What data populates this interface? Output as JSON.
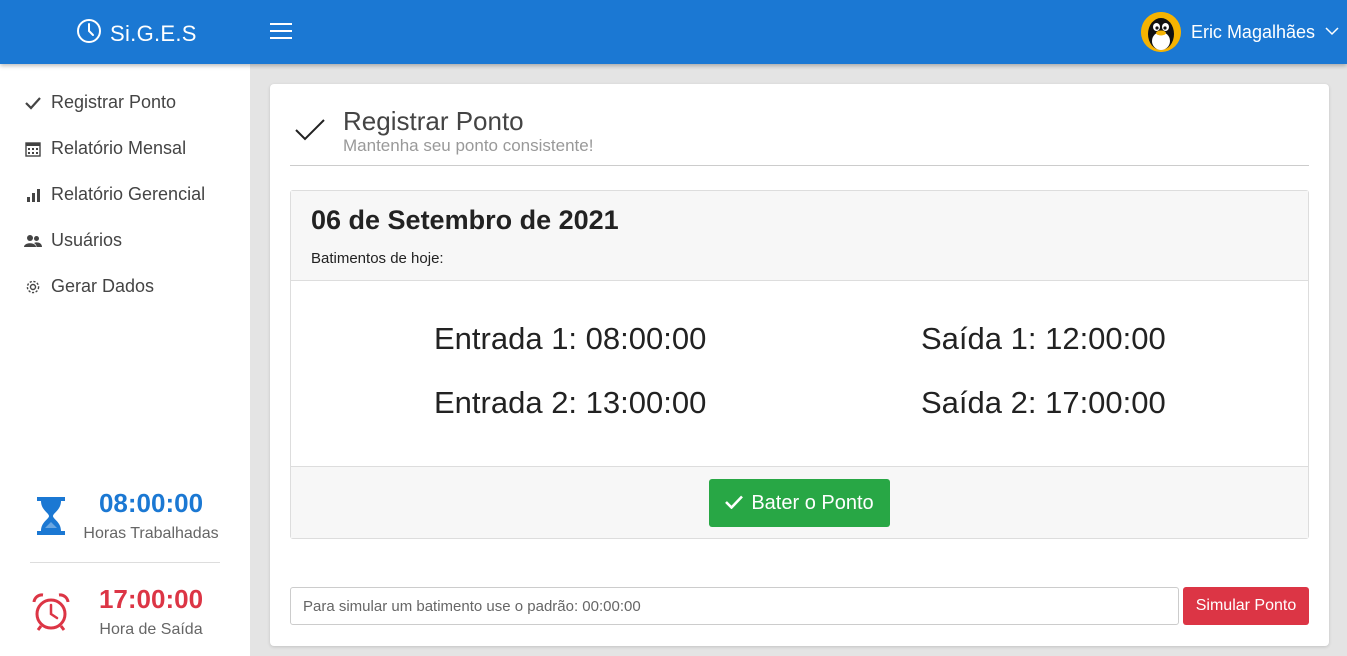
{
  "header": {
    "brand": "Si.G.E.S",
    "user_name": "Eric Magalhães"
  },
  "sidebar": {
    "items": [
      {
        "label": "Registrar Ponto",
        "icon": "check-icon"
      },
      {
        "label": "Relatório Mensal",
        "icon": "calendar-icon"
      },
      {
        "label": "Relatório Gerencial",
        "icon": "bar-chart-icon"
      },
      {
        "label": "Usuários",
        "icon": "users-icon"
      },
      {
        "label": "Gerar Dados",
        "icon": "gear-icon"
      }
    ],
    "stats": {
      "hours_worked": {
        "value": "08:00:00",
        "label": "Horas Trabalhadas",
        "color": "#1b78d3"
      },
      "exit_time": {
        "value": "17:00:00",
        "label": "Hora de Saída",
        "color": "#dc3545"
      }
    }
  },
  "main": {
    "title": "Registrar Ponto",
    "subtitle": "Mantenha seu ponto consistente!",
    "panel": {
      "date": "06 de Setembro de 2021",
      "subtitle": "Batimentos de hoje:",
      "punches": {
        "entrada1": "Entrada 1: 08:00:00",
        "saida1": "Saída 1: 12:00:00",
        "entrada2": "Entrada 2: 13:00:00",
        "saida2": "Saída 2: 17:00:00"
      },
      "button_label": "Bater o Ponto"
    },
    "simulate": {
      "placeholder": "Para simular um batimento use o padrão: 00:00:00",
      "button_label": "Simular Ponto"
    }
  },
  "colors": {
    "header": "#1b78d3",
    "success": "#28a745",
    "danger": "#dc3545"
  }
}
